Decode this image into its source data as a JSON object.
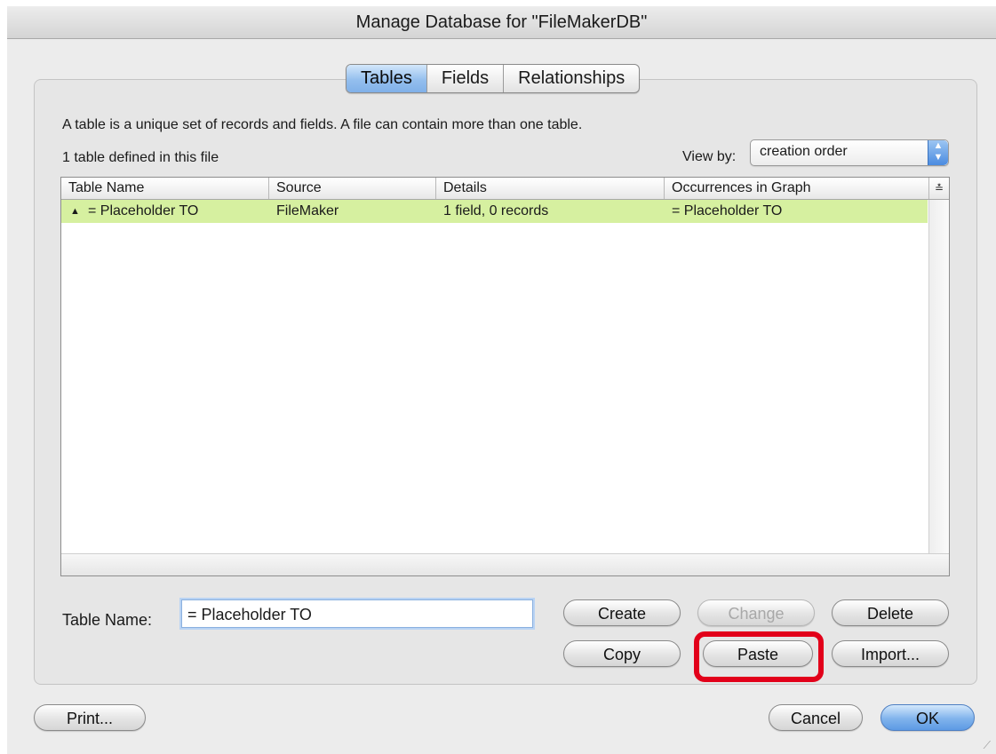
{
  "window": {
    "title": "Manage Database for \"FileMakerDB\""
  },
  "tabs": [
    {
      "label": "Tables",
      "active": true
    },
    {
      "label": "Fields",
      "active": false
    },
    {
      "label": "Relationships",
      "active": false
    }
  ],
  "description": "A table is a unique set of records and fields. A file can contain more than one table.",
  "count_text": "1 table defined in this file",
  "view_by": {
    "label": "View by:",
    "value": "creation order"
  },
  "table": {
    "columns": [
      "Table Name",
      "Source",
      "Details",
      "Occurrences in Graph"
    ],
    "rows": [
      {
        "name": "= Placeholder TO",
        "source": "FileMaker",
        "details": "1 field, 0 records",
        "occurrences": "= Placeholder TO",
        "selected": true
      }
    ]
  },
  "table_name_field": {
    "label": "Table Name:",
    "value": "= Placeholder TO"
  },
  "buttons": {
    "create": "Create",
    "change": "Change",
    "delete": "Delete",
    "copy": "Copy",
    "paste": "Paste",
    "import": "Import...",
    "print": "Print...",
    "cancel": "Cancel",
    "ok": "OK"
  },
  "colors": {
    "selected_row": "#d6f0a0",
    "highlight": "#e2001a",
    "accent": "#80b0e8"
  }
}
